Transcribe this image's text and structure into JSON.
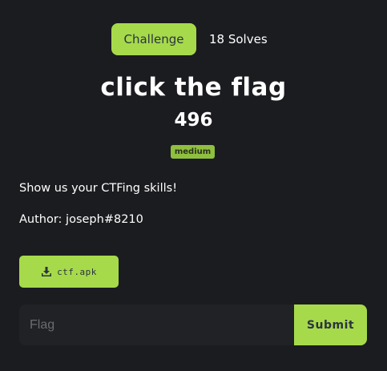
{
  "tabs": {
    "challenge_label": "Challenge",
    "solves_label": "18 Solves"
  },
  "challenge": {
    "title": "click the flag",
    "points": "496",
    "difficulty": "medium",
    "description_lines": [
      "Show us your CTFing skills!",
      "Author: joseph#8210"
    ]
  },
  "files": [
    {
      "name": "ctf.apk",
      "icon": "download-icon"
    }
  ],
  "flag_form": {
    "placeholder": "Flag",
    "value": "",
    "submit_label": "Submit"
  },
  "colors": {
    "background": "#1b1c20",
    "accent": "#a6da4b",
    "tag": "#8fbf3e",
    "input_bg": "#212226",
    "dark_text": "#2b3340"
  }
}
